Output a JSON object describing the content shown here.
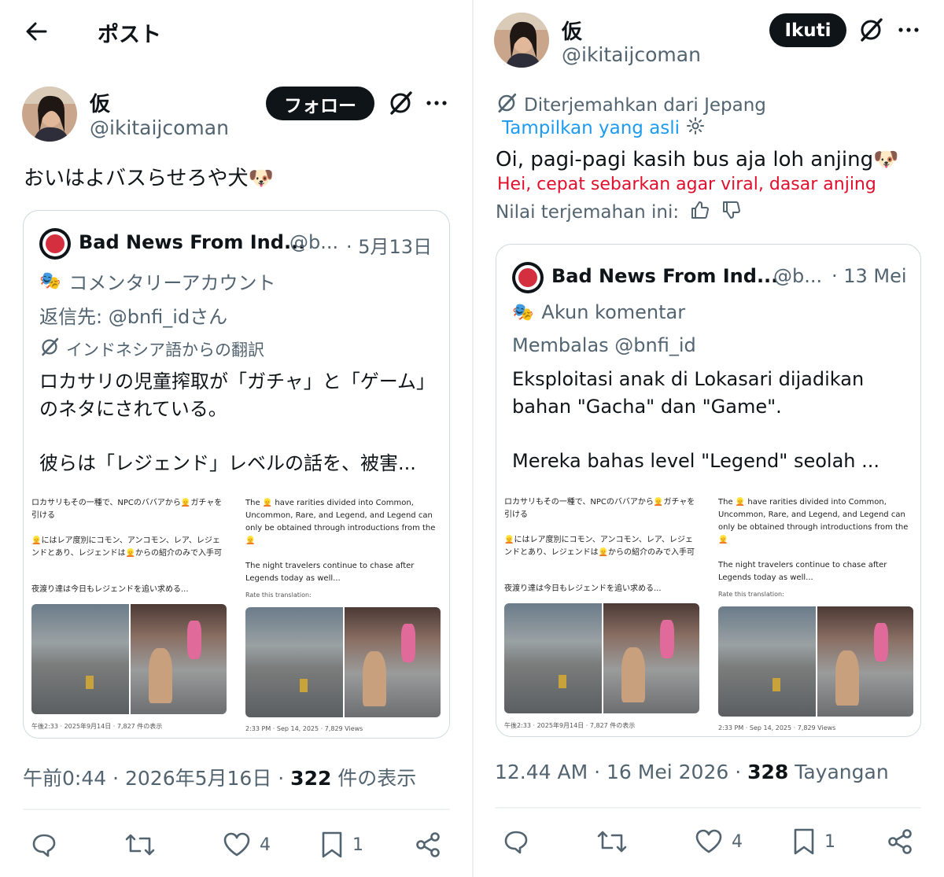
{
  "left": {
    "header_title": "ポスト",
    "author": {
      "name": "仮",
      "handle": "@ikitaijcoman"
    },
    "follow_label": "フォロー",
    "post_text": "おいはよバスらせろや犬",
    "quote": {
      "name": "Bad News From Ind...",
      "handle": "@b...",
      "date": "· 5月13日",
      "account_label": "コメンタリーアカウント",
      "reply_to": "返信先: @bnfi_idさん",
      "translated_from": "インドネシア語からの翻訳",
      "body_1": "ロカサリの児童搾取が「ガチャ」と「ゲーム」のネタにされている。",
      "body_2": "彼らは「レジェンド」レベルの話を、被害..."
    },
    "meta": {
      "time": "午前0:44 · 2026年5月16日 · ",
      "views": "322",
      "views_label": " 件の表示"
    },
    "actions": {
      "likes": "4",
      "bookmarks": "1"
    }
  },
  "right": {
    "author": {
      "name": "仮",
      "handle": "@ikitaijcoman"
    },
    "follow_label": "Ikuti",
    "translated_from": "Diterjemahkan dari Jepang",
    "show_original": "Tampilkan yang asli",
    "post_text": "Oi, pagi-pagi kasih bus aja loh anjing",
    "annotation": "Hei, cepat sebarkan agar viral, dasar anjing",
    "rate_label": "Nilai terjemahan ini:",
    "quote": {
      "name": "Bad News From Ind...",
      "handle": "@b...",
      "date": "· 13 Mei",
      "account_label": "Akun komentar",
      "reply_to": "Membalas @bnfi_id",
      "body_1": "Eksploitasi anak di Lokasari dijadikan bahan \"Gacha\" dan \"Game\".",
      "body_2": "Mereka bahas level \"Legend\" seolah ..."
    },
    "meta": {
      "time": "12.44 AM · 16 Mei 2026 · ",
      "views": "328",
      "views_label": " Tayangan"
    },
    "actions": {
      "likes": "4",
      "bookmarks": "1"
    }
  },
  "embedded_screenshot": {
    "jp_text_1": "ロカサリもその一種で、NPCのババアから👱ガチャを引ける",
    "jp_text_2": "👱にはレア度別にコモン、アンコモン、レア、レジェンドとあり、レジェンドは👱からの紹介のみで入手可",
    "jp_text_3": "夜渡り達は今日もレジェンドを追い求める...",
    "en_text_1": "The 👱 have rarities divided into Common, Uncommon, Rare, and Legend, and Legend can only be obtained through introductions from the 👱",
    "en_text_2": "The night travelers continue to chase after Legends today as well...",
    "rate_small": "Rate this translation:",
    "jp_footer": "午後2:33 · 2025年9月14日 · 7,827 件の表示",
    "en_footer": "2:33 PM · Sep 14, 2025 · 7,829 Views"
  },
  "colors": {
    "follow_bg": "#0f1419",
    "link": "#1d9bf0",
    "red_annotation": "#e0102c",
    "secondary": "#536471"
  }
}
